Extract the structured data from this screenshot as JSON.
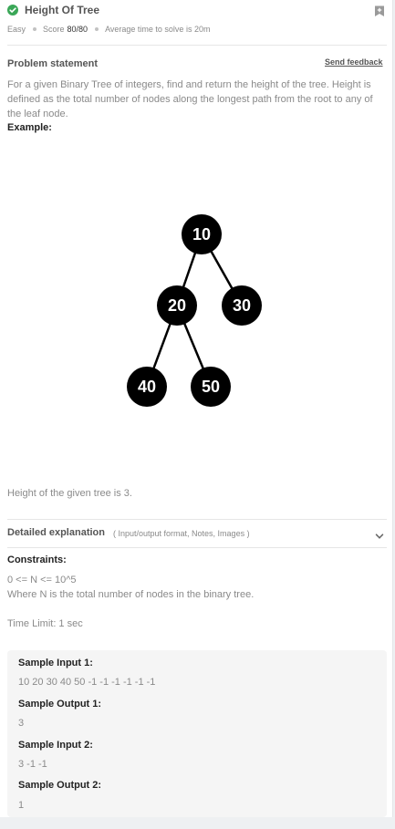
{
  "header": {
    "title": "Height Of Tree",
    "difficulty": "Easy",
    "score_label": "Score",
    "score_value": "80/80",
    "avg_time": "Average time to solve is 20m"
  },
  "problem": {
    "section_title": "Problem statement",
    "feedback_link": "Send feedback",
    "statement": "For a given Binary Tree of integers, find and return the height of the tree. Height is defined as the total number of nodes along the longest path from the root to any of the leaf node.",
    "example_label": "Example:",
    "result_text": "Height of the given tree is 3."
  },
  "tree_nodes": [
    "10",
    "20",
    "30",
    "40",
    "50"
  ],
  "explanation": {
    "title": "Detailed explanation",
    "subtitle": "( Input/output format, Notes, Images )"
  },
  "constraints": {
    "title": "Constraints:",
    "line1": "0 <= N <= 10^5",
    "line2": "Where N is the total number of nodes in the binary tree.",
    "time_limit": "Time Limit: 1 sec"
  },
  "samples": {
    "input1_label": "Sample Input 1:",
    "input1_value": "10 20 30 40 50 -1 -1 -1 -1 -1 -1",
    "output1_label": "Sample Output 1:",
    "output1_value": "3",
    "input2_label": "Sample Input 2:",
    "input2_value": "3 -1 -1",
    "output2_label": "Sample Output 2:",
    "output2_value": "1"
  },
  "colors": {
    "solved": "#3aa757",
    "node": "#000000",
    "panel": "#ffffff",
    "background": "#eef0f2"
  },
  "icons": [
    "check-circle-icon",
    "bookmark-icon",
    "chevron-down-icon"
  ]
}
